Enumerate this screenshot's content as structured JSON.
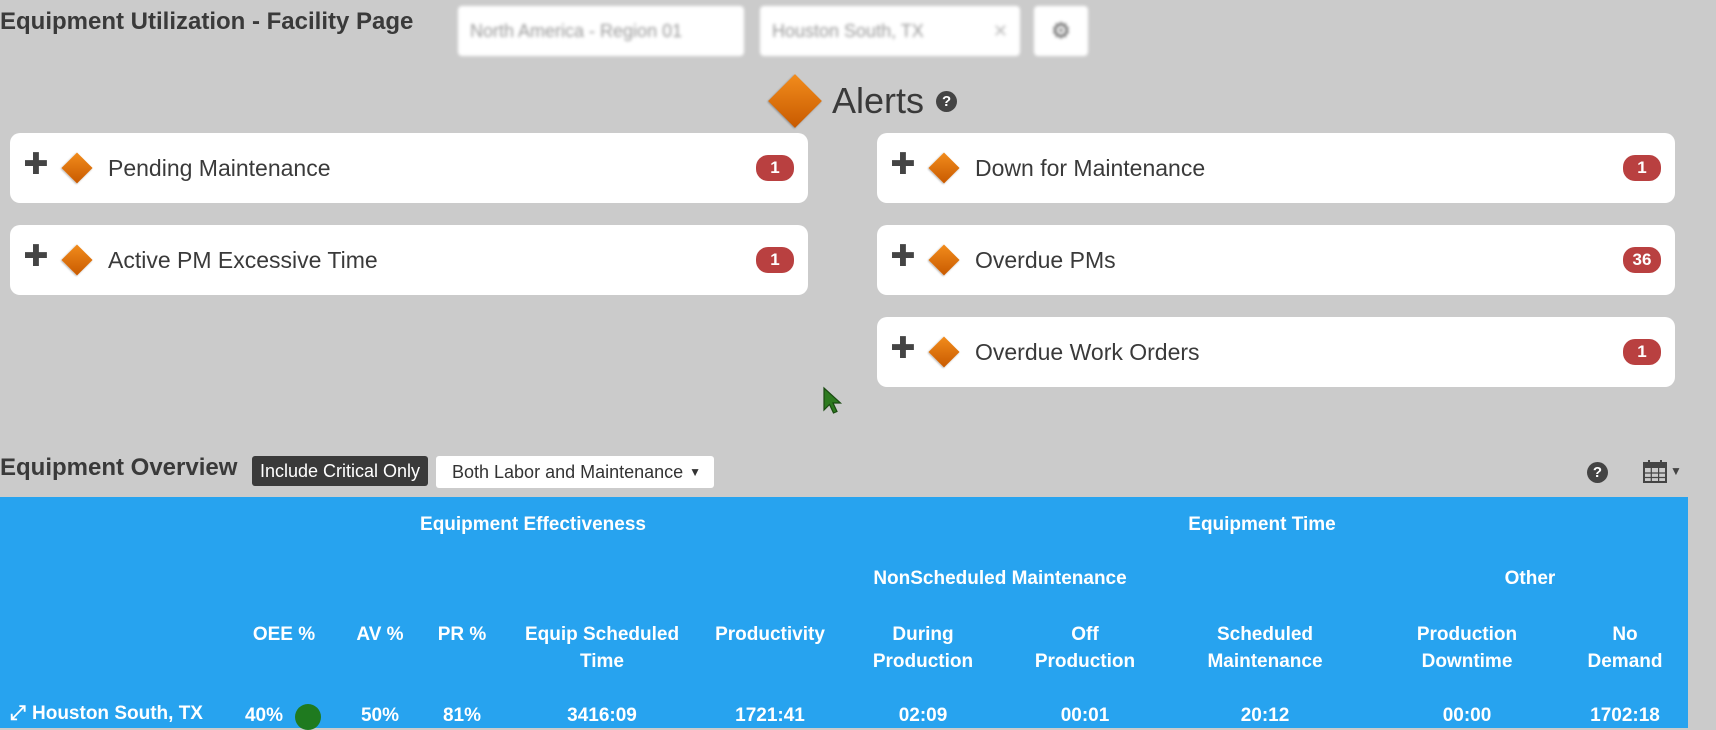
{
  "header": {
    "title": "Equipment Utilization - Facility Page",
    "region_select": "North America - Region 01",
    "facility_select": "Houston South, TX",
    "settings_icon": "gear-icon"
  },
  "alerts": {
    "title": "Alerts",
    "help": "?",
    "cards": [
      {
        "label": "Pending Maintenance",
        "count": "1"
      },
      {
        "label": "Active PM Excessive Time",
        "count": "1"
      },
      {
        "label": "Down for Maintenance",
        "count": "1"
      },
      {
        "label": "Overdue PMs",
        "count": "36"
      },
      {
        "label": "Overdue Work Orders",
        "count": "1"
      }
    ],
    "expand_symbol": "✚"
  },
  "overview": {
    "title": "Equipment Overview",
    "critical_button": "Include Critical Only",
    "labor_select": "Both Labor and Maintenance",
    "help": "?"
  },
  "table": {
    "groups": {
      "effectiveness": "Equipment Effectiveness",
      "time": "Equipment Time",
      "nonscheduled": "NonScheduled Maintenance",
      "other": "Other"
    },
    "columns": {
      "oee": "OEE %",
      "av": "AV %",
      "pr": "PR %",
      "scheduled_time_1": "Equip Scheduled",
      "scheduled_time_2": "Time",
      "productivity": "Productivity",
      "during_1": "During",
      "during_2": "Production",
      "off_1": "Off",
      "off_2": "Production",
      "sched_maint_1": "Scheduled",
      "sched_maint_2": "Maintenance",
      "prod_down_1": "Production",
      "prod_down_2": "Downtime",
      "no_demand_1": "No",
      "no_demand_2": "Demand"
    },
    "row": {
      "name": "Houston South, TX",
      "oee": "40%",
      "av": "50%",
      "pr": "81%",
      "scheduled_time": "3416:09",
      "productivity": "1721:41",
      "during": "02:09",
      "off": "00:01",
      "sched_maint": "20:12",
      "prod_down": "00:00",
      "no_demand": "1702:18",
      "status_color": "#1f7a1f"
    }
  },
  "colors": {
    "accent_orange": "#e07010",
    "badge_red": "#b94040",
    "table_blue": "#27a3ef"
  }
}
